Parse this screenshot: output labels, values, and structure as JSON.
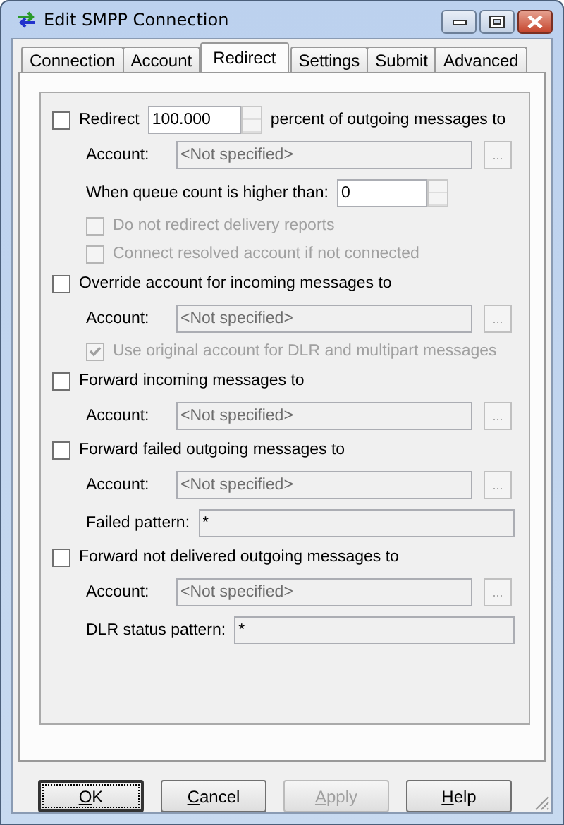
{
  "window": {
    "title": "Edit SMPP Connection"
  },
  "tabs": [
    {
      "label": "Connection",
      "selected": false
    },
    {
      "label": "Account",
      "selected": false
    },
    {
      "label": "Redirect",
      "selected": true
    },
    {
      "label": "Settings",
      "selected": false
    },
    {
      "label": "Submit",
      "selected": false
    },
    {
      "label": "Advanced",
      "selected": false
    }
  ],
  "rows": [
    {
      "kind": "check",
      "label": "Redirect",
      "checked": false,
      "disabled": false,
      "spin_value": "100.000",
      "suffix": "percent of outgoing messages to"
    },
    {
      "kind": "account",
      "label": "Account:",
      "value": "<Not specified>",
      "browse": "..."
    },
    {
      "kind": "queue",
      "label": "When queue count is higher than:",
      "value": "0"
    },
    {
      "kind": "subcheck",
      "label": "Do not redirect delivery reports",
      "checked": false,
      "disabled": true
    },
    {
      "kind": "subcheck",
      "label": "Connect resolved account if not connected",
      "checked": false,
      "disabled": true
    },
    {
      "kind": "check",
      "label": "Override account for incoming messages to",
      "checked": false,
      "disabled": false
    },
    {
      "kind": "account",
      "label": "Account:",
      "value": "<Not specified>",
      "browse": "..."
    },
    {
      "kind": "subcheck",
      "label": "Use original account for DLR and multipart messages",
      "checked": true,
      "disabled": true
    },
    {
      "kind": "check",
      "label": "Forward incoming messages to",
      "checked": false,
      "disabled": false
    },
    {
      "kind": "account",
      "label": "Account:",
      "value": "<Not specified>",
      "browse": "..."
    },
    {
      "kind": "check",
      "label": "Forward failed outgoing messages to",
      "checked": false,
      "disabled": false
    },
    {
      "kind": "account",
      "label": "Account:",
      "value": "<Not specified>",
      "browse": "..."
    },
    {
      "kind": "pattern",
      "label": "Failed pattern:",
      "value": "*"
    },
    {
      "kind": "check",
      "label": "Forward not delivered outgoing messages to",
      "checked": false,
      "disabled": false
    },
    {
      "kind": "account",
      "label": "Account:",
      "value": "<Not specified>",
      "browse": "..."
    },
    {
      "kind": "pattern",
      "label": "DLR status pattern:",
      "value": "*"
    }
  ],
  "buttons": [
    {
      "label": "OK",
      "default": true,
      "disabled": false
    },
    {
      "label": "Cancel",
      "default": false,
      "disabled": false
    },
    {
      "label": "Apply",
      "default": false,
      "disabled": true
    },
    {
      "label": "Help",
      "default": false,
      "disabled": false
    }
  ]
}
